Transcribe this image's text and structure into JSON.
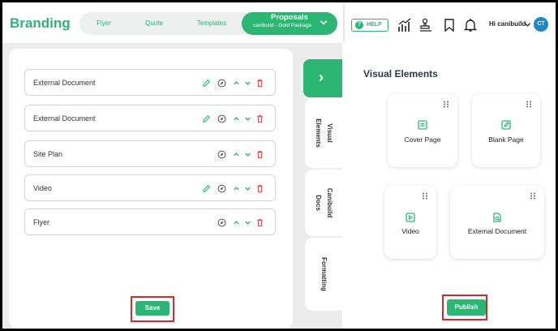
{
  "app": {
    "brand": "Branding"
  },
  "nav": {
    "tabs": [
      {
        "label": "Flyer"
      },
      {
        "label": "Quote"
      },
      {
        "label": "Templates"
      }
    ],
    "active": {
      "label": "Proposals",
      "sublabel": "canibuild - Gold Package"
    }
  },
  "header": {
    "help_label": "HELP",
    "help_glyph": "?",
    "user_greeting": "Hi canibuild",
    "avatar_initials": "CT",
    "icons": [
      "chart-icon",
      "stamp-icon",
      "bookmark-icon",
      "bell-icon"
    ]
  },
  "documents": {
    "items": [
      {
        "label": "External Document",
        "editable": true
      },
      {
        "label": "External Document",
        "editable": true
      },
      {
        "label": "Site Plan",
        "editable": false
      },
      {
        "label": "Video",
        "editable": true
      },
      {
        "label": "Flyer",
        "editable": false
      }
    ],
    "save_label": "Save"
  },
  "side_tabs": {
    "arrow_glyph": "›",
    "tabs": [
      {
        "line1": "Visual",
        "line2": "Elements"
      },
      {
        "line1": "Canibuild",
        "line2": "Docs"
      },
      {
        "line1": "Formatting",
        "line2": ""
      }
    ]
  },
  "visual_elements": {
    "title": "Visual Elements",
    "cards": [
      {
        "label": "Cover Page",
        "icon": "cover-page-icon"
      },
      {
        "label": "Blank Page",
        "icon": "blank-page-icon"
      },
      {
        "label": "Video",
        "icon": "video-icon"
      },
      {
        "label": "External Document",
        "icon": "external-document-icon"
      }
    ],
    "publish_label": "Publish"
  },
  "colors": {
    "accent": "#2bb673",
    "highlight": "#d42a2a",
    "delete": "#e04848",
    "avatar": "#1f86c8"
  }
}
